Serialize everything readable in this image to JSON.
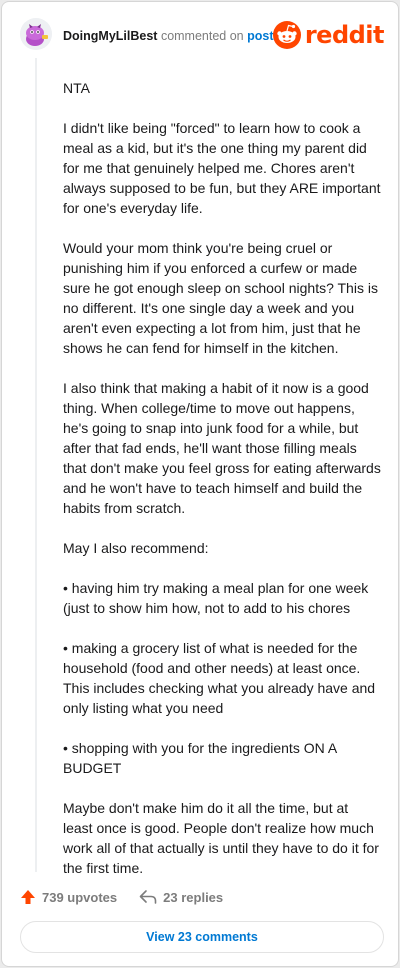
{
  "comment": {
    "username": "DoingMyLilBest",
    "action_text": "commented on",
    "post_link": "post",
    "paragraphs": [
      "NTA",
      "I didn't like being \"forced\" to learn how to cook a meal as a kid, but it's the one thing my parent did for me that genuinely helped me. Chores aren't always supposed to be fun, but they ARE important for one's everyday life.",
      "Would your mom think you're being cruel or punishing him if you enforced a curfew or made sure he got enough sleep on school nights? This is no different. It's one single day a week and you aren't even expecting a lot from him, just that he shows he can fend for himself in the kitchen.",
      "I also think that making a habit of it now is a good thing. When college/time to move out happens, he's going to snap into junk food for a while, but after that fad ends, he'll want those filling meals that don't make you feel gross for eating afterwards and he won't have to teach himself and build the habits from scratch.",
      "May I also recommend:",
      "• having him try making a meal plan for one week (just to show him how, not to add to his chores",
      "• making a grocery list of what is needed for the household (food and other needs) at least once. This includes checking what you already have and only listing what you need",
      "• shopping with you for the ingredients ON A BUDGET",
      "Maybe don't make him do it all the time, but at least once is good. People don't realize how much work all of that actually is until they have to do it for the first time."
    ],
    "upvotes": "739 upvotes",
    "replies": "23 replies",
    "view_comments": "View 23 comments"
  },
  "brand": {
    "logo_text": "reddit",
    "accent": "#ff4500",
    "link_color": "#0079d3",
    "muted_color": "#7c7c7c"
  },
  "icons": {
    "avatar": "snoo-avatar-purple",
    "logo": "reddit-snoo-icon",
    "upvote": "upvote-arrow-icon",
    "reply": "reply-arrow-icon"
  }
}
